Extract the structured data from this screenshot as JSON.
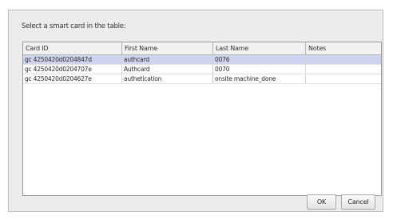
{
  "dialog": {
    "prompt": "Select a smart card in the table:",
    "ok_label": "OK",
    "cancel_label": "Cancel"
  },
  "table": {
    "columns": [
      "Card ID",
      "First Name",
      "Last Name",
      "Notes"
    ],
    "rows": [
      {
        "card_id": "gc 4250420d0204847d",
        "first_name": "authcard",
        "last_name": "0076",
        "notes": "",
        "selected": true
      },
      {
        "card_id": "gc 4250420d0204707e",
        "first_name": "Authcard",
        "last_name": "0070",
        "notes": "",
        "selected": false
      },
      {
        "card_id": "gc 4250420d0204627e",
        "first_name": "authetication",
        "last_name": "onsite machine_done",
        "notes": "",
        "selected": false
      }
    ]
  },
  "colors": {
    "selected_row": "#cfd3ee",
    "dialog_bg": "#ececec"
  }
}
